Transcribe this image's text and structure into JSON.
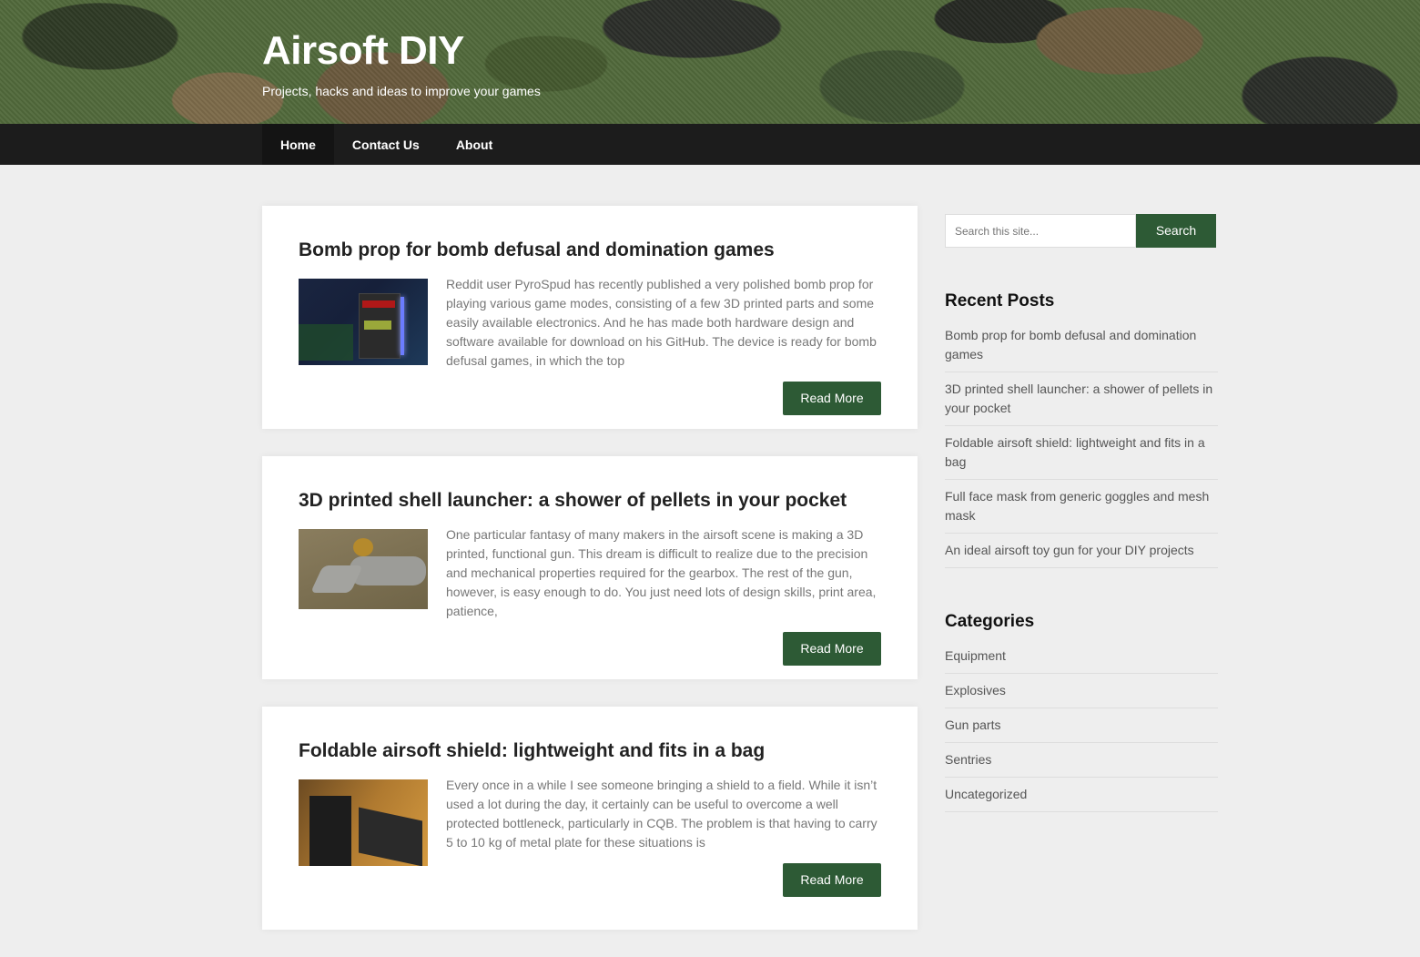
{
  "header": {
    "site_title": "Airsoft DIY",
    "site_description": "Projects, hacks and ideas to improve your games"
  },
  "nav": {
    "items": [
      {
        "label": "Home"
      },
      {
        "label": "Contact Us"
      },
      {
        "label": "About"
      }
    ]
  },
  "posts": [
    {
      "title": "Bomb prop for bomb defusal and domination games",
      "excerpt": "Reddit user PyroSpud has recently published a very polished bomb prop for playing various game modes, consisting of a few 3D printed parts and some easily available electronics. And he has made both hardware design and software available for download on his GitHub. The device is ready for bomb defusal games, in which the top",
      "read_more": "Read More"
    },
    {
      "title": "3D printed shell launcher: a shower of pellets in your pocket",
      "excerpt": "One particular fantasy of many makers in the airsoft scene is making a 3D printed, functional gun. This dream is difficult to realize due to the precision and mechanical properties required for the gearbox. The rest of the gun, however, is easy enough to do. You just need lots of design skills, print area, patience,",
      "read_more": "Read More"
    },
    {
      "title": "Foldable airsoft shield: lightweight and fits in a bag",
      "excerpt": "Every once in a while I see someone bringing a shield to a field. While it isn’t used a lot during the day, it certainly can be useful to overcome a well protected bottleneck, particularly in CQB. The problem is that having to carry 5 to 10 kg of metal plate for these situations is",
      "read_more": "Read More"
    }
  ],
  "sidebar": {
    "search": {
      "placeholder": "Search this site...",
      "button": "Search"
    },
    "recent_posts": {
      "title": "Recent Posts",
      "items": [
        "Bomb prop for bomb defusal and domination games",
        "3D printed shell launcher: a shower of pellets in your pocket",
        "Foldable airsoft shield: lightweight and fits in a bag",
        "Full face mask from generic goggles and mesh mask",
        "An ideal airsoft toy gun for your DIY projects"
      ]
    },
    "categories": {
      "title": "Categories",
      "items": [
        "Equipment",
        "Explosives",
        "Gun parts",
        "Sentries",
        "Uncategorized"
      ]
    }
  },
  "colors": {
    "accent": "#2d5a35",
    "nav_bg": "#1c1c1c"
  }
}
